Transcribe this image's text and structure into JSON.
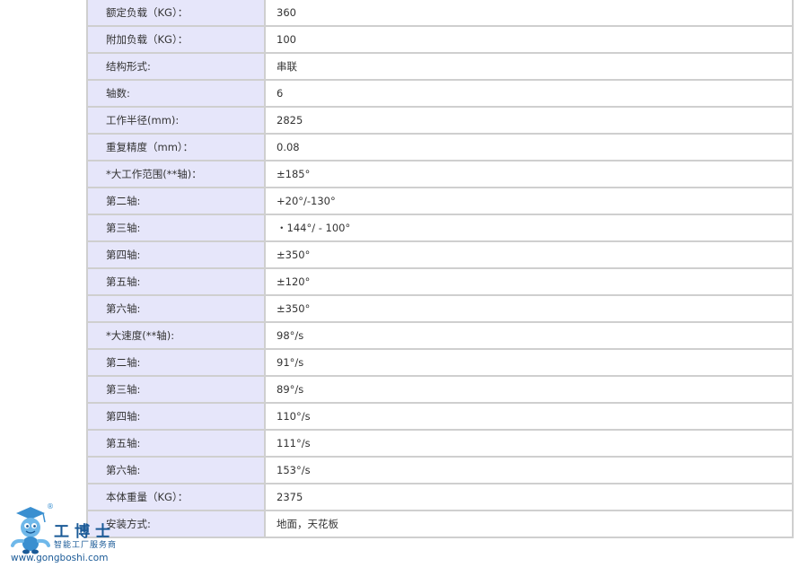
{
  "spec_rows": [
    {
      "label": "额定负载（KG）：",
      "value": "360"
    },
    {
      "label": "附加负载（KG）：",
      "value": "100"
    },
    {
      "label": "结构形式:",
      "value": "串联"
    },
    {
      "label": "轴数:",
      "value": "6"
    },
    {
      "label": "工作半径(mm):",
      "value": "2825"
    },
    {
      "label": "重复精度（mm）：",
      "value": "0.08"
    },
    {
      "label": "*大工作范围(**轴)：",
      "value": "±185°"
    },
    {
      "label": "第二轴:",
      "value": "+20°/-130°"
    },
    {
      "label": "第三轴:",
      "value": "・144°/ - 100°"
    },
    {
      "label": "第四轴:",
      "value": "±350°"
    },
    {
      "label": "第五轴:",
      "value": "±120°"
    },
    {
      "label": "第六轴:",
      "value": "±350°"
    },
    {
      "label": "*大速度(**轴):",
      "value": "98°/s"
    },
    {
      "label": "第二轴:",
      "value": "91°/s"
    },
    {
      "label": "第三轴:",
      "value": "89°/s"
    },
    {
      "label": "第四轴:",
      "value": "110°/s"
    },
    {
      "label": "第五轴:",
      "value": "111°/s"
    },
    {
      "label": "第六轴:",
      "value": "153°/s"
    },
    {
      "label": "本体重量（KG）：",
      "value": "2375"
    },
    {
      "label": "安装方式:",
      "value": "地面，天花板"
    }
  ],
  "watermark": {
    "brand": "工博士",
    "tagline": "智能工厂服务商",
    "site": "www.gongboshi.com",
    "reg_mark": "®",
    "icon": "robot-mascot-icon",
    "brand_color": "#1a5a97"
  }
}
